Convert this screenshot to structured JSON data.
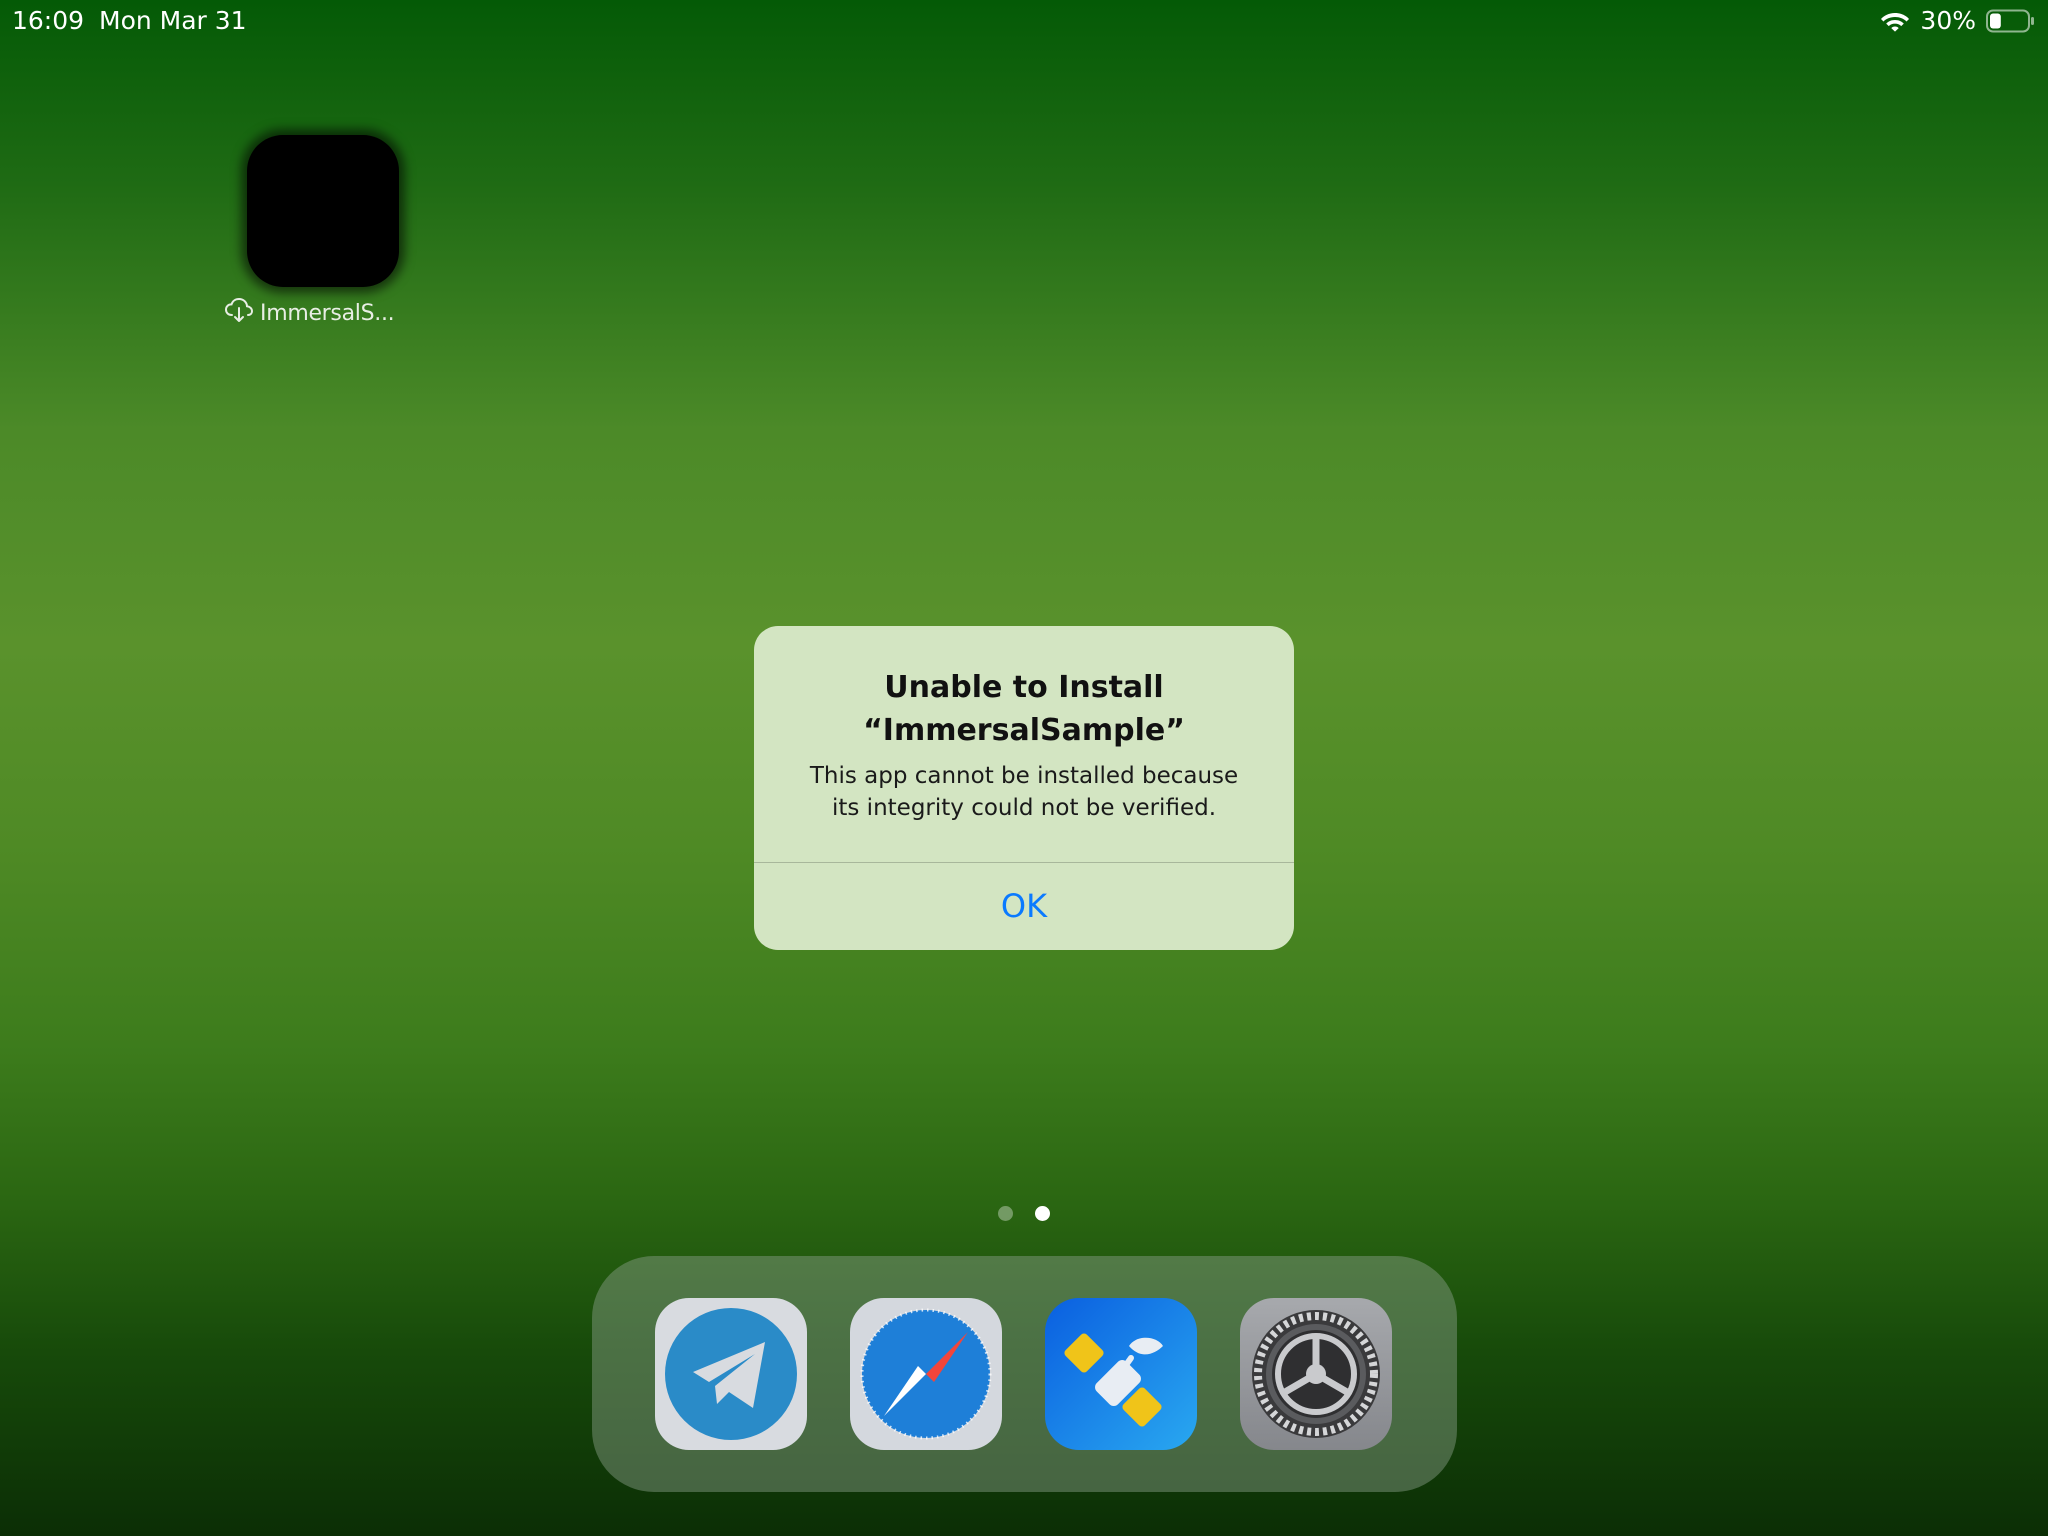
{
  "status_bar": {
    "time": "16:09",
    "date": "Mon Mar 31",
    "battery_percent": "30%",
    "battery_level": 0.3,
    "wifi_icon": "wifi-icon",
    "battery_icon": "battery-icon"
  },
  "home_screen": {
    "apps": [
      {
        "label": "ImmersalS...",
        "status_icon": "cloud-download-icon"
      }
    ],
    "page_count": 2,
    "current_page": 2
  },
  "alert": {
    "title": "Unable to Install\n“ImmersalSample”",
    "message": "This app cannot be installed because\nits integrity could not be verified.",
    "button_label": "OK"
  },
  "dock": {
    "apps": [
      {
        "icon": "telegram-icon"
      },
      {
        "icon": "safari-icon"
      },
      {
        "icon": "satellite-app-icon"
      },
      {
        "icon": "settings-icon"
      }
    ]
  },
  "colors": {
    "alert_background": "#d3e5c2",
    "alert_button": "#0a7aff",
    "wallpaper_top": "#045a06",
    "wallpaper_mid": "#5a922c",
    "wallpaper_bottom": "#0b2e05"
  }
}
